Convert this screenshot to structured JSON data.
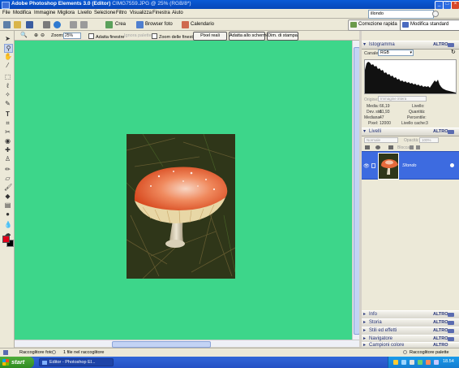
{
  "window": {
    "title": "Adobe Photoshop Elements 3.0 (Editor)",
    "document_subtitle": "CIMG7559.JPG @ 25% (RGB/8*)"
  },
  "menubar": {
    "items": [
      "File",
      "Modifica",
      "Immagine",
      "Migliora",
      "Livello",
      "Selezione",
      "Filtro",
      "Visualizza",
      "Finestra",
      "Aiuto"
    ],
    "search_value": "illondo"
  },
  "shortcuts": {
    "crea": "Crea",
    "browser_foto": "Browser foto",
    "calendario": "Calendario",
    "correzione_rapida": "Correzione rapida",
    "modifica_standard": "Modifica standard"
  },
  "options": {
    "zoom_label": "Zoom:",
    "zoom_value": "25%",
    "adatta_finestre": "Adatta finestre",
    "ignora_palette": "Ignora palette",
    "zoom_finestre": "Zoom delle finestre",
    "pixel_reali": "Pixel reali",
    "adatta_schermo": "Adatta allo schermo",
    "dim_stampa": "Dim. di stampa"
  },
  "palettes": {
    "more_label": "ALTRO",
    "istogramma": {
      "title": "Istogramma",
      "canale_label": "Canale:",
      "canale_value": "RGB",
      "origine_label": "Origine:",
      "origine_value": "Immagine intera",
      "media_label": "Media:",
      "media_value": "66,19",
      "devstd_label": "Dev. std:",
      "devstd_value": "61,93",
      "mediana_label": "Mediana:",
      "mediana_value": "47",
      "pixel_label": "Pixel:",
      "pixel_value": "12000",
      "livello_label": "Livello:",
      "quantita_label": "Quantità:",
      "percentile_label": "Percentile:",
      "livello_cache_label": "Livello cache:",
      "livello_cache_value": "3"
    },
    "livelli": {
      "title": "Livelli",
      "blend_mode": "Normale",
      "opacity_label": "Opacità:",
      "opacity_value": "100%",
      "blocca_label": "Blocca:",
      "layer_name": "Sfondo"
    },
    "collapsed": [
      "Info",
      "Storia",
      "Stili ed effetti",
      "Navigatore",
      "Campioni colore"
    ]
  },
  "statusbar": {
    "raccoglitore_foto": "Raccoglitore foto",
    "file_count": "1 file nel raccoglitore",
    "raccoglitore_palette": "Raccoglitore palette"
  },
  "taskbar": {
    "start": "start",
    "task_label": "Editor - Photoshop El...",
    "clock": "18.54"
  },
  "colors": {
    "canvas_background": "#3dd68a",
    "foreground_color": "#e2001a",
    "background_color": "#000000",
    "selected_layer": "#3d6be0"
  },
  "icons": {
    "toolbox": [
      "move-tool-icon",
      "zoom-tool-icon",
      "hand-tool-icon",
      "eyedropper-tool-icon",
      "marquee-tool-icon",
      "lasso-tool-icon",
      "magic-wand-icon",
      "selection-brush-icon",
      "type-tool-icon",
      "crop-tool-icon",
      "cookie-cutter-icon",
      "red-eye-icon",
      "healing-brush-icon",
      "clone-stamp-icon",
      "pencil-tool-icon",
      "eraser-tool-icon",
      "brush-tool-icon",
      "paint-bucket-icon",
      "gradient-tool-icon",
      "shape-tool-icon",
      "blur-tool-icon",
      "sponge-tool-icon"
    ]
  }
}
